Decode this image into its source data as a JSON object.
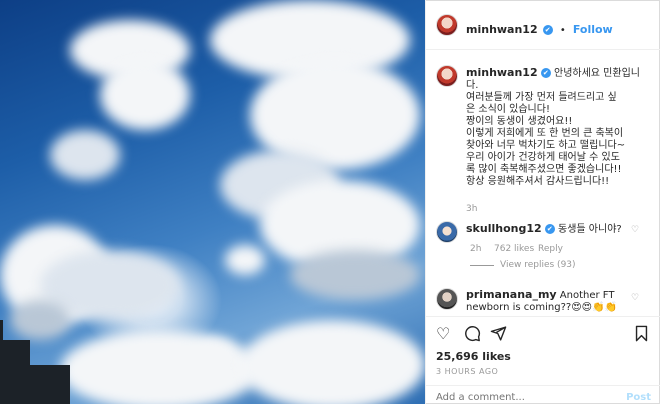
{
  "header": {
    "username": "minhwan12",
    "verified_mark": "✔",
    "follow_label": "Follow",
    "separator": "•"
  },
  "caption": {
    "username": "minhwan12",
    "verified_mark": "✔",
    "lines": [
      "안녕하세요 민환입니",
      "다.",
      "여러분들께 가장 먼저 들려드리고 싶",
      "은 소식이 있습니다!",
      "짱이의 동생이 생겼어요!!",
      "이렇게 저희에게 또 한 번의 큰 축복이",
      "찾아와 너무 벅차기도 하고 떨립니다~",
      "우리 아이가 건강하게 태어날 수 있도",
      "록 많이 축복해주셨으면 좋겠습니다!!",
      "항상 응원해주셔서 감사드립니다!!"
    ],
    "time": "3h"
  },
  "comments": [
    {
      "username": "skullhong12",
      "verified_mark": "✔",
      "text": "동생들 아니야?",
      "time": "2h",
      "likes": "762 likes",
      "reply": "Reply",
      "view_replies": "View replies (93)"
    },
    {
      "username": "primanana_my",
      "text_line1": "Another FT",
      "text_line2": "newborn is coming??😍😍👏👏"
    }
  ],
  "actions": {
    "likes": "25,696 likes",
    "time": "3 HOURS AGO",
    "comment_placeholder": "Add a comment...",
    "post_label": "Post"
  },
  "icons": {
    "like": "heart-icon",
    "comment": "comment-icon",
    "share": "share-icon",
    "save": "bookmark-icon"
  }
}
